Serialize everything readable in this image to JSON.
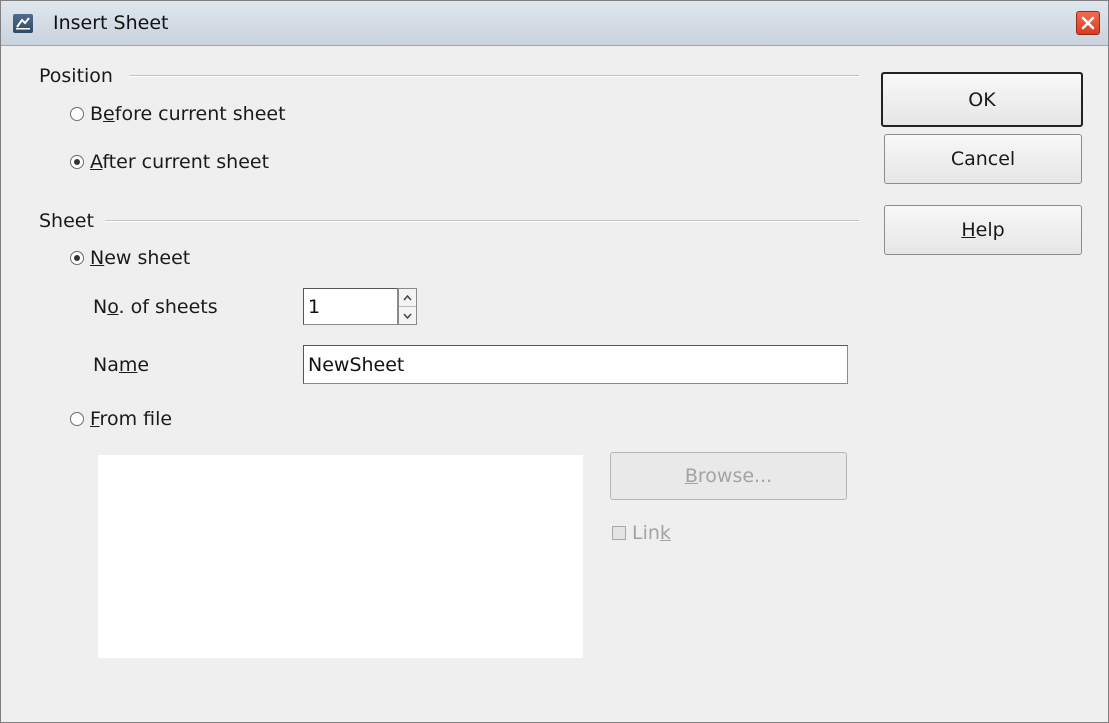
{
  "window": {
    "title": "Insert Sheet",
    "close_label": "close"
  },
  "position": {
    "label": "Position",
    "options": [
      {
        "pre": "B",
        "mn": "e",
        "post": "fore current sheet",
        "checked": false
      },
      {
        "pre": "",
        "mn": "A",
        "post": "fter current sheet",
        "checked": true
      }
    ]
  },
  "sheet": {
    "label": "Sheet",
    "new_sheet": {
      "pre": "",
      "mn": "N",
      "post": "ew sheet",
      "checked": true
    },
    "count": {
      "pre": "N",
      "mn": "o",
      "post": ". of sheets",
      "value": "1"
    },
    "name": {
      "pre": "Na",
      "mn": "m",
      "post": "e",
      "value": "NewSheet"
    },
    "from_file": {
      "pre": "",
      "mn": "F",
      "post": "rom file",
      "checked": false
    },
    "browse": {
      "pre": "",
      "mn": "B",
      "post": "rowse...",
      "disabled": true
    },
    "link": {
      "pre": "Lin",
      "mn": "k",
      "post": "",
      "checked": false,
      "disabled": true
    }
  },
  "buttons": {
    "ok": {
      "pre": "OK",
      "mn": "",
      "post": ""
    },
    "cancel": {
      "pre": "Cancel",
      "mn": "",
      "post": ""
    },
    "help": {
      "pre": "",
      "mn": "H",
      "post": "elp"
    }
  }
}
